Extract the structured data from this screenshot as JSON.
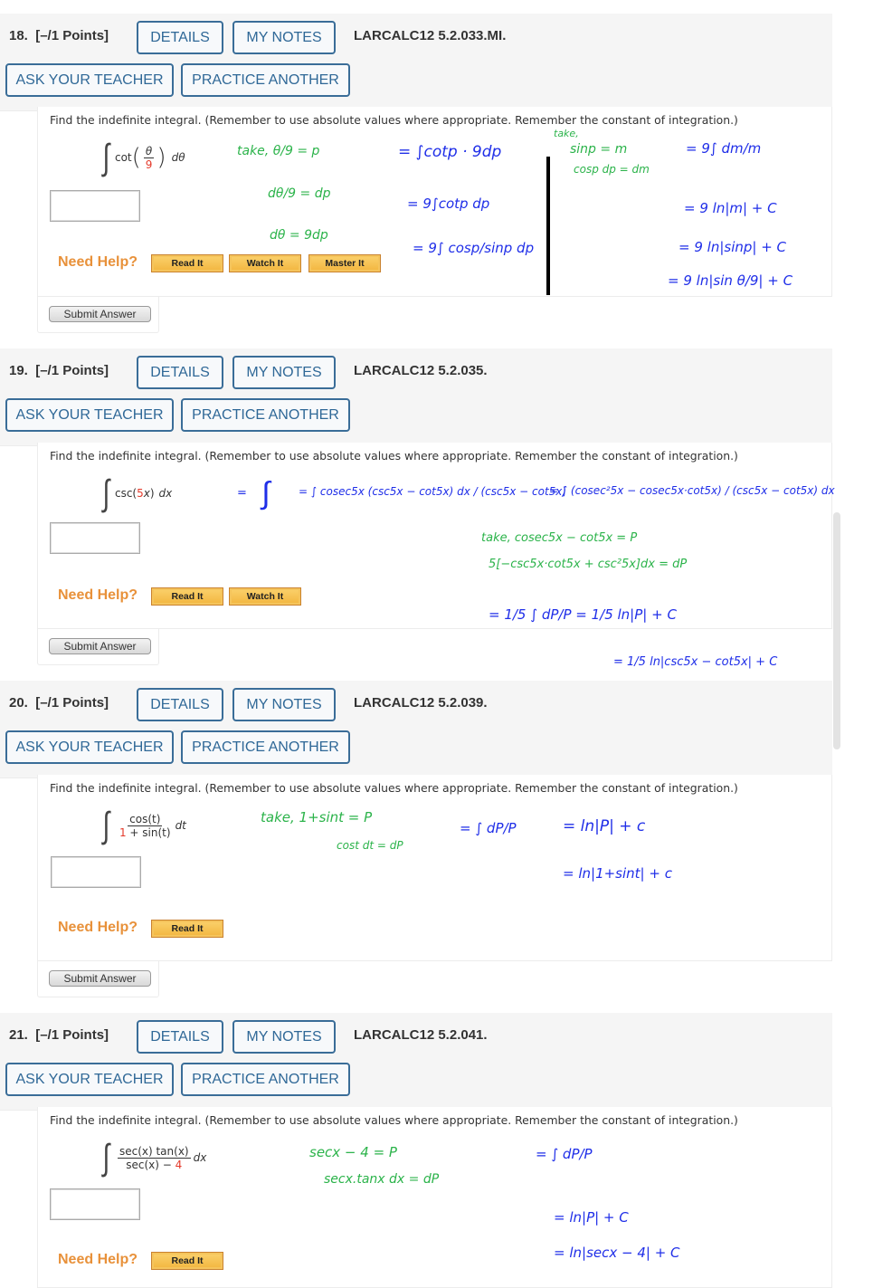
{
  "common": {
    "details_label": "DETAILS",
    "notes_label": "MY NOTES",
    "ask_label": "ASK YOUR TEACHER",
    "practice_label": "PRACTICE ANOTHER",
    "prompt": "Find the indefinite integral. (Remember to use absolute values where appropriate. Remember the constant of integration.)",
    "need_help": "Need Help?",
    "read_it": "Read It",
    "watch_it": "Watch It",
    "master_it": "Master It",
    "submit": "Submit Answer"
  },
  "colors": {
    "header_button_border": "#3a6d98",
    "need_help": "#e8913a",
    "help_button": "#f2b53e",
    "ink_green": "#2bb34a",
    "ink_blue": "#1f2ee8",
    "highlight_red": "#e43a2b"
  },
  "questions": [
    {
      "number": "18.",
      "points": "[–/1 Points]",
      "code": "LARCALC12 5.2.033.MI.",
      "integral": {
        "fn": "cot",
        "num": "θ",
        "den": "9",
        "dvar": "dθ"
      },
      "answer_value": "",
      "help_buttons": [
        "Read It",
        "Watch It",
        "Master It"
      ],
      "handwriting": {
        "green": [
          "take, θ/9 = p",
          "dθ/9 = dp",
          "dθ = 9dp",
          "take,",
          "sinp = m",
          "cosp dp = dm"
        ],
        "blue": [
          "= ∫cotp · 9dp",
          "= 9∫cotp dp",
          "= 9∫ cosp/sinp dp",
          "= 9∫ dm/m",
          "= 9 ln|m| + C",
          "= 9 ln|sinp| + C",
          "= 9 ln|sin θ/9| + C"
        ]
      }
    },
    {
      "number": "19.",
      "points": "[–/1 Points]",
      "code": "LARCALC12 5.2.035.",
      "integral": {
        "pre": "csc(",
        "coef": "5",
        "var": "x",
        "post": ")",
        "dvar": "dx"
      },
      "answer_value": "",
      "help_buttons": [
        "Read It",
        "Watch It"
      ],
      "handwriting": {
        "green": [
          "take, cosec5x − cot5x = P",
          "5[−csc5x·cot5x + csc²5x]dx = dP"
        ],
        "blue": [
          "= ∫ cosec5x (csc5x − cot5x) dx / (csc5x − cot5x)",
          "= ∫ (cosec²5x − cosec5x·cot5x) / (csc5x − cot5x) dx",
          "= 1/5 ∫ dP/P = 1/5 ln|P| + C",
          "= 1/5 ln|csc5x − cot5x| + C"
        ]
      }
    },
    {
      "number": "20.",
      "points": "[–/1 Points]",
      "code": "LARCALC12 5.2.039.",
      "integral": {
        "num": "cos(t)",
        "den_coef": "1",
        "den_rest": " + sin(t)",
        "dvar": "dt"
      },
      "answer_value": "",
      "help_buttons": [
        "Read It"
      ],
      "handwriting": {
        "green": [
          "take, 1+sint = P",
          "cost dt = dP"
        ],
        "blue": [
          "= ∫ dP/P",
          "= ln|P| + c",
          "= ln|1+sint| + c"
        ]
      }
    },
    {
      "number": "21.",
      "points": "[–/1 Points]",
      "code": "LARCALC12 5.2.041.",
      "integral": {
        "num": "sec(x) tan(x)",
        "den_pre": "sec(x) − ",
        "den_coef": "4",
        "dvar": "dx"
      },
      "answer_value": "",
      "help_buttons": [
        "Read It"
      ],
      "handwriting": {
        "green": [
          "secx − 4 = P",
          "secx.tanx dx = dP"
        ],
        "blue": [
          "= ∫ dP/P",
          "= ln|P| + C",
          "= ln|secx − 4| + C"
        ]
      }
    }
  ]
}
